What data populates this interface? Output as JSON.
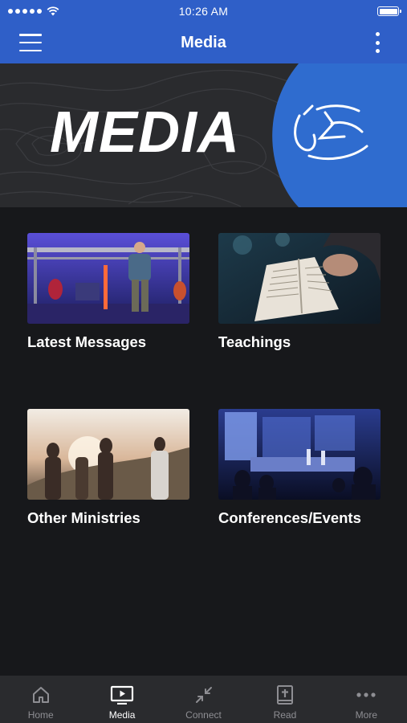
{
  "status": {
    "time": "10:26 AM"
  },
  "header": {
    "title": "Media"
  },
  "banner": {
    "title": "MEDIA"
  },
  "cards": [
    {
      "label": "Latest Messages"
    },
    {
      "label": "Teachings"
    },
    {
      "label": "Other Ministries"
    },
    {
      "label": "Conferences/Events"
    }
  ],
  "tabs": [
    {
      "label": "Home",
      "icon": "home-icon"
    },
    {
      "label": "Media",
      "icon": "tv-play-icon",
      "active": true
    },
    {
      "label": "Connect",
      "icon": "arrows-inward-icon"
    },
    {
      "label": "Read",
      "icon": "bible-icon"
    },
    {
      "label": "More",
      "icon": "ellipsis-icon"
    }
  ],
  "colors": {
    "brand_blue": "#2f5fc8",
    "background": "#17181b",
    "tabbar": "#2a2b2e",
    "inactive": "#8e8e93"
  }
}
